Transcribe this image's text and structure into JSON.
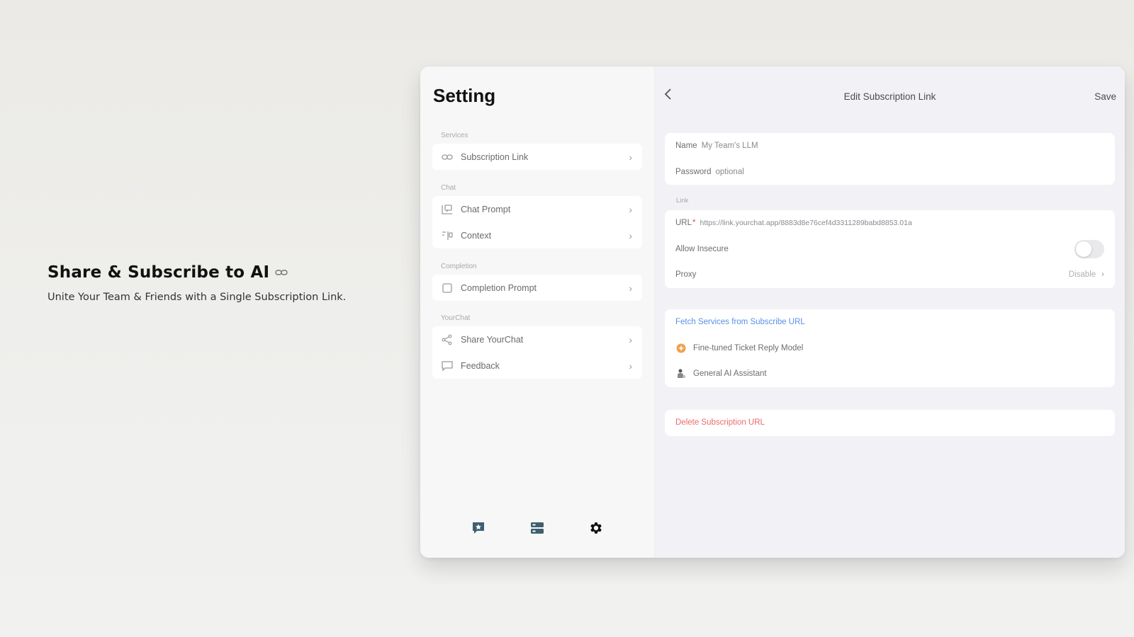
{
  "promo": {
    "title": "Share & Subscribe to AI",
    "subtitle": "Unite Your Team & Friends with a Single Subscription Link."
  },
  "sidebar": {
    "title": "Setting",
    "sections": [
      {
        "label": "Services",
        "items": [
          {
            "label": "Subscription Link",
            "icon": "link-icon"
          }
        ]
      },
      {
        "label": "Chat",
        "items": [
          {
            "label": "Chat Prompt",
            "icon": "chat-prompt-icon"
          },
          {
            "label": "Context",
            "icon": "context-icon"
          }
        ]
      },
      {
        "label": "Completion",
        "items": [
          {
            "label": "Completion Prompt",
            "icon": "square-icon"
          }
        ]
      },
      {
        "label": "YourChat",
        "items": [
          {
            "label": "Share YourChat",
            "icon": "share-icon"
          },
          {
            "label": "Feedback",
            "icon": "feedback-icon"
          }
        ]
      }
    ],
    "tabs": [
      "chat-tab-icon",
      "services-tab-icon",
      "gear-icon"
    ]
  },
  "detail": {
    "back_icon": "chevron-left-icon",
    "title": "Edit Subscription Link",
    "save_label": "Save",
    "name_label": "Name",
    "name_value": "My Team's LLM",
    "password_label": "Password",
    "password_placeholder": "optional",
    "link_section_label": "Link",
    "url_label": "URL",
    "url_required": "*",
    "url_value": "https://link.yourchat.app/8883d8e76cef4d3311289babd8853.01a",
    "allow_insecure_label": "Allow Insecure",
    "allow_insecure_on": false,
    "proxy_label": "Proxy",
    "proxy_value": "Disable",
    "fetch_label": "Fetch Services from Subscribe URL",
    "services": [
      {
        "name": "Fine-tuned Ticket Reply Model",
        "icon": "sparkle-icon"
      },
      {
        "name": "General AI Assistant",
        "icon": "assistant-icon"
      }
    ],
    "delete_label": "Delete Subscription URL"
  },
  "colors": {
    "accent_blue": "#5b8ee6",
    "danger_red": "#ea6b6b",
    "service_orange": "#f0a04b"
  }
}
